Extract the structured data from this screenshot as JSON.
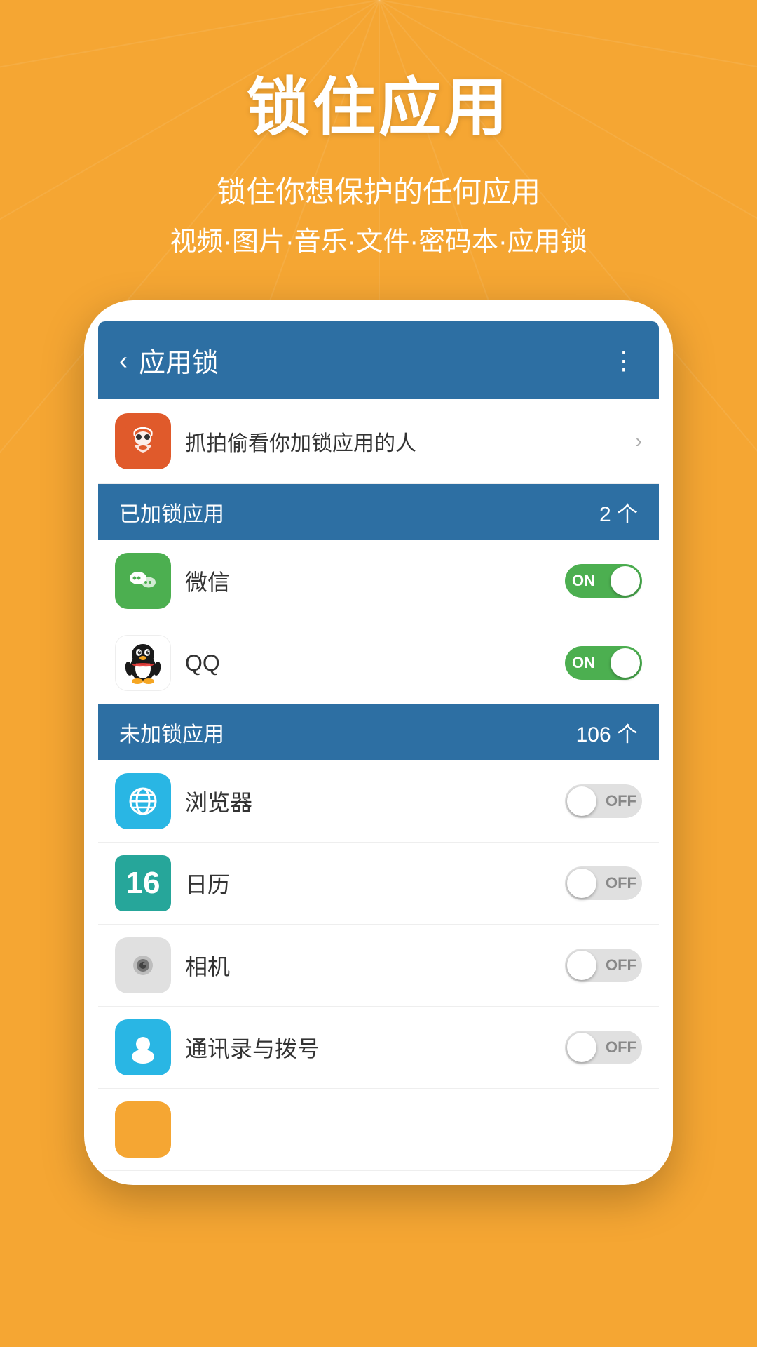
{
  "background": {
    "color": "#f5a633"
  },
  "header": {
    "title": "锁住应用",
    "subtitle1": "锁住你想保护的任何应用",
    "subtitle2": "视频·图片·音乐·文件·密码本·应用锁"
  },
  "appbar": {
    "back_label": "‹",
    "title": "应用锁",
    "more_label": "⋮"
  },
  "spy_row": {
    "text": "抓拍偷看你加锁应用的人",
    "chevron": "›"
  },
  "locked_section": {
    "title": "已加锁应用",
    "count": "2 个"
  },
  "locked_apps": [
    {
      "name": "微信",
      "toggle": "ON",
      "icon_type": "wechat"
    },
    {
      "name": "QQ",
      "toggle": "ON",
      "icon_type": "qq"
    }
  ],
  "unlocked_section": {
    "title": "未加锁应用",
    "count": "106 个"
  },
  "unlocked_apps": [
    {
      "name": "浏览器",
      "toggle": "OFF",
      "icon_type": "browser"
    },
    {
      "name": "日历",
      "toggle": "OFF",
      "icon_type": "calendar",
      "calendar_number": "16"
    },
    {
      "name": "相机",
      "toggle": "OFF",
      "icon_type": "camera"
    },
    {
      "name": "通讯录与拨号",
      "toggle": "OFF",
      "icon_type": "contacts"
    }
  ],
  "partial_app": {
    "icon_type": "orange"
  }
}
